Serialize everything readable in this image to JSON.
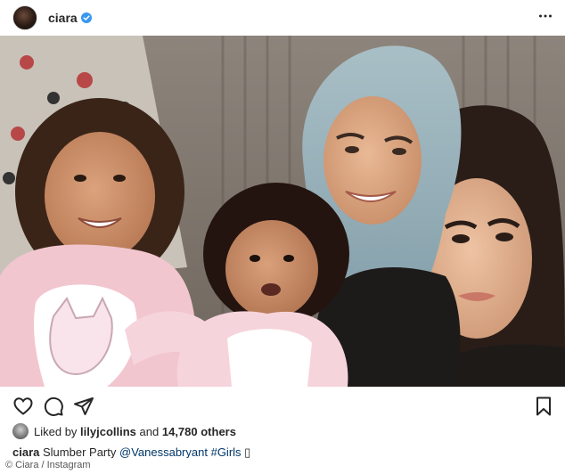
{
  "post": {
    "username": "ciara",
    "verified": true,
    "likes": {
      "prefix": "Liked by",
      "user": "lilyjcollins",
      "joiner": "and",
      "others": "14,780 others"
    },
    "caption": {
      "username": "ciara",
      "text": "Slumber Party",
      "mention": "@Vanessabryant",
      "hashtag": "#Girls",
      "emoji": "▯"
    }
  },
  "credit": "© Ciara / Instagram",
  "icons": {
    "verified": "verified-badge-icon",
    "more": "more-options-icon",
    "like": "heart-icon",
    "comment": "comment-icon",
    "share": "share-icon",
    "save": "bookmark-icon"
  },
  "colors": {
    "verified_blue": "#3897f0",
    "text": "#262626",
    "link": "#00376b"
  }
}
